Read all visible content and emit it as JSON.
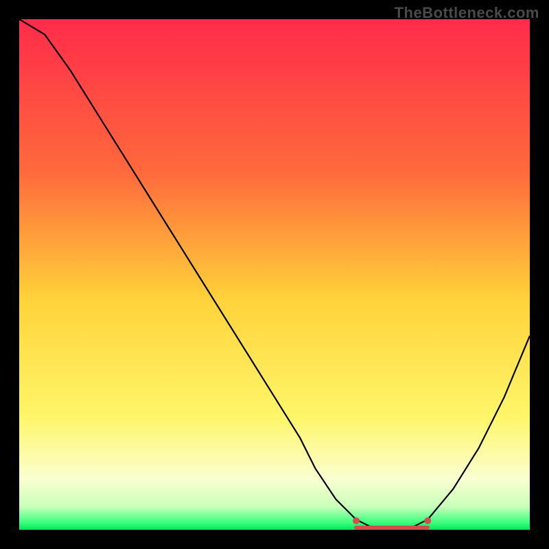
{
  "watermark": "TheBottleneck.com",
  "colors": {
    "frame": "#000000",
    "curve": "#000000",
    "marker": "#d1504e",
    "gradient_stops": [
      {
        "offset": 0.0,
        "color": "#ff2b4a"
      },
      {
        "offset": 0.3,
        "color": "#ff6a3c"
      },
      {
        "offset": 0.55,
        "color": "#ffd33a"
      },
      {
        "offset": 0.78,
        "color": "#fff66a"
      },
      {
        "offset": 0.9,
        "color": "#faffd0"
      },
      {
        "offset": 0.955,
        "color": "#c8ffbb"
      },
      {
        "offset": 0.985,
        "color": "#3fff7e"
      },
      {
        "offset": 1.0,
        "color": "#00e85a"
      }
    ]
  },
  "chart_data": {
    "type": "line",
    "title": "",
    "xlabel": "",
    "ylabel": "",
    "x_range": [
      0,
      100
    ],
    "y_range": [
      0,
      100
    ],
    "series": [
      {
        "name": "bottleneck-curve",
        "x": [
          0,
          5,
          10,
          15,
          20,
          25,
          30,
          35,
          40,
          45,
          50,
          55,
          58,
          62,
          66,
          70,
          73,
          76,
          80,
          85,
          90,
          95,
          100
        ],
        "y": [
          100,
          97,
          90,
          82,
          74,
          66,
          58,
          50,
          42,
          34,
          26,
          18,
          12,
          6,
          2,
          0,
          0,
          0,
          2,
          8,
          16,
          26,
          38
        ]
      }
    ],
    "optimal_band": {
      "x_start": 66,
      "x_end": 80,
      "y": 0
    },
    "optimal_markers": [
      {
        "x": 66,
        "y": 1.5
      },
      {
        "x": 80,
        "y": 1.5
      }
    ]
  }
}
